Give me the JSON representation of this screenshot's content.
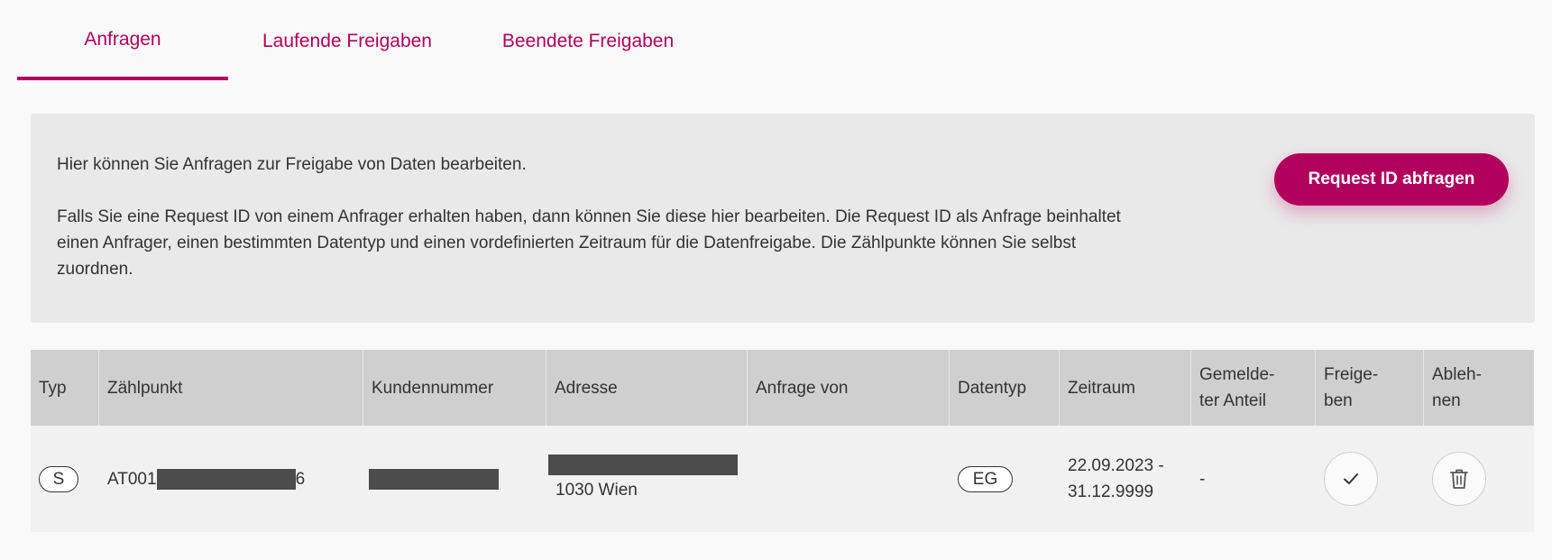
{
  "tabs": [
    {
      "label": "Anfragen",
      "active": true
    },
    {
      "label": "Laufende Freigaben",
      "active": false
    },
    {
      "label": "Beendete Freigaben",
      "active": false
    }
  ],
  "info": {
    "line1": "Hier können Sie Anfragen zur Freigabe von Daten bearbeiten.",
    "line2": "Falls Sie eine Request ID von einem Anfrager erhalten haben, dann können Sie diese hier bearbeiten. Die Request ID als Anfrage beinhaltet einen Anfrager, einen bestimmten Datentyp und einen vordefinierten Zeitraum für die Datenfreigabe. Die Zählpunkte können Sie selbst zuordnen.",
    "request_button": "Request ID abfragen"
  },
  "table": {
    "headers": {
      "typ": "Typ",
      "zaehlpunkt": "Zählpunkt",
      "kundennummer": "Kundennummer",
      "adresse": "Adresse",
      "anfrage_von": "Anfrage von",
      "datentyp": "Datentyp",
      "zeitraum": "Zeitraum",
      "gemeldeter_anteil_1": "Gemelde-",
      "gemeldeter_anteil_2": "ter Anteil",
      "freigeben_1": "Freige-",
      "freigeben_2": "ben",
      "ablehnen_1": "Ableh-",
      "ablehnen_2": "nen"
    },
    "rows": [
      {
        "typ": "S",
        "zaehlpunkt_prefix": "AT001",
        "zaehlpunkt_suffix": "6",
        "adresse_city": "1030 Wien",
        "anfrage_von": "",
        "datentyp": "EG",
        "zeitraum_1": "22.09.2023 -",
        "zeitraum_2": "31.12.9999",
        "gemeldeter_anteil": "-"
      }
    ]
  },
  "colors": {
    "brand": "#b2005d",
    "header_bg": "#cfcfcf",
    "panel_bg": "#e9e9e9",
    "row_bg": "#f1f1f1",
    "redaction": "#4c4c4c"
  },
  "icons": {
    "approve": "checkmark-icon",
    "reject": "trash-icon"
  }
}
